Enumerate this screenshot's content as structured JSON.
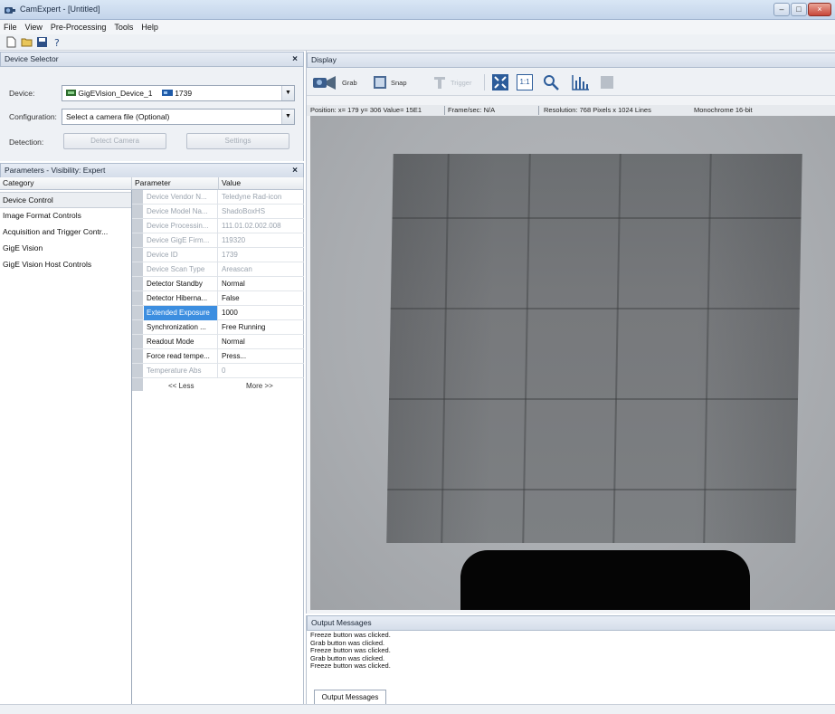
{
  "window": {
    "title": "CamExpert - [Untitled]",
    "controls": {
      "minimize": "–",
      "maximize": "□",
      "close": "×"
    }
  },
  "menu": [
    "File",
    "View",
    "Pre-Processing",
    "Tools",
    "Help"
  ],
  "toolbar": {
    "icons": [
      "new-file-icon",
      "open-folder-icon",
      "save-icon",
      "help-icon"
    ]
  },
  "device_selector": {
    "header": "Device Selector",
    "close": "×",
    "device_label": "Device:",
    "device_value": "GigEVision_Device_1",
    "device_id": "1739",
    "configuration_label": "Configuration:",
    "configuration_value": "Select a camera file (Optional)",
    "detection_label": "Detection:",
    "detect_button": "Detect Camera",
    "settings_button": "Settings"
  },
  "parameters": {
    "header": "Parameters - Visibility: Expert",
    "close": "×",
    "category_header": "Category",
    "parameter_header": "Parameter",
    "value_header": "Value",
    "categories": [
      "Device Control",
      "Image Format Controls",
      "Acquisition and Trigger Contr...",
      "GigE Vision",
      "GigE Vision Host Controls"
    ],
    "rows": [
      {
        "name": "Device Vendor N...",
        "value": "Teledyne Rad-icon",
        "readonly": true
      },
      {
        "name": "Device Model Na...",
        "value": "ShadoBoxHS",
        "readonly": true
      },
      {
        "name": "Device Processin...",
        "value": "111.01.02.002.008",
        "readonly": true
      },
      {
        "name": "Device GigE Firm...",
        "value": "119320",
        "readonly": true
      },
      {
        "name": "Device ID",
        "value": "1739",
        "readonly": true
      },
      {
        "name": "Device Scan Type",
        "value": "Areascan",
        "readonly": true
      },
      {
        "name": "Detector Standby",
        "value": "Normal",
        "readonly": false
      },
      {
        "name": "Detector Hiberna...",
        "value": "False",
        "readonly": false
      },
      {
        "name": "Extended Exposure",
        "value": "1000",
        "readonly": false,
        "highlight": true
      },
      {
        "name": "Synchronization ...",
        "value": "Free Running",
        "readonly": false
      },
      {
        "name": "Readout Mode",
        "value": "Normal",
        "readonly": false
      },
      {
        "name": "Force read tempe...",
        "value": "Press...",
        "readonly": false
      },
      {
        "name": "Temperature Abs",
        "value": "0",
        "readonly": true
      }
    ],
    "less_link": "<< Less",
    "more_link": "More >>"
  },
  "display": {
    "header": "Display",
    "buttons": {
      "grab": "Grab",
      "snap": "Snap",
      "trigger": "Trigger",
      "one_to_one": "1:1"
    },
    "status": {
      "position": "Position: x= 179 y= 306 Value= 15E1",
      "frame_rate": "Frame/sec: N/A",
      "resolution": "Resolution: 768 Pixels x 1024 Lines",
      "format": "Monochrome 16-bit"
    }
  },
  "output": {
    "header": "Output Messages",
    "messages": [
      "Freeze button was clicked.",
      "Grab button was clicked.",
      "Freeze button was clicked.",
      "Grab button was clicked.",
      "Freeze button was clicked."
    ],
    "tab": "Output Messages"
  },
  "colors": {
    "selection": "#3c8ee0",
    "panel_header": "#d5deea",
    "image_bg": "#aaadb1",
    "object": "#6c6f72"
  }
}
